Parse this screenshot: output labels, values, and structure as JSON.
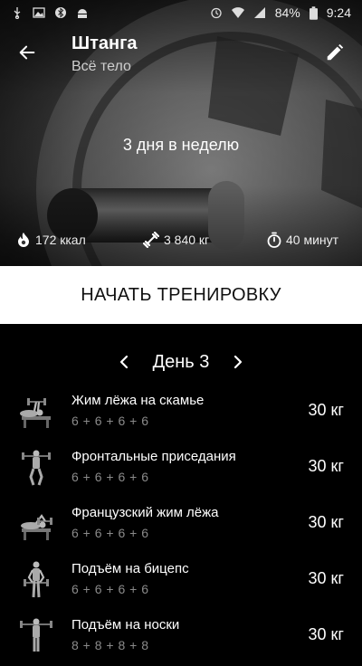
{
  "status_bar": {
    "battery": "84%",
    "time": "9:24",
    "left_icons": [
      "usb-icon",
      "image-icon",
      "bluetooth-icon",
      "android-icon"
    ],
    "right_icons": [
      "alarm-icon",
      "wifi-icon",
      "signal-icon",
      "battery-icon"
    ]
  },
  "header": {
    "title": "Штанга",
    "subtitle": "Всё тело",
    "frequency": "3 дня в неделю"
  },
  "stats": {
    "calories": "172 ккал",
    "weight": "3 840 кг",
    "duration": "40 минут"
  },
  "start_button": "НАЧАТЬ ТРЕНИРОВКУ",
  "day": {
    "label": "День 3"
  },
  "exercises": [
    {
      "name": "Жим лёжа на скамье",
      "reps": "6 + 6 + 6 + 6",
      "weight": "30 кг"
    },
    {
      "name": "Фронтальные приседания",
      "reps": "6 + 6 + 6 + 6",
      "weight": "30 кг"
    },
    {
      "name": "Французский жим лёжа",
      "reps": "6 + 6 + 6 + 6",
      "weight": "30 кг"
    },
    {
      "name": "Подъём на бицепс",
      "reps": "6 + 6 + 6 + 6",
      "weight": "30 кг"
    },
    {
      "name": "Подъём на носки",
      "reps": "8 + 8 + 8 + 8",
      "weight": "30 кг"
    }
  ]
}
